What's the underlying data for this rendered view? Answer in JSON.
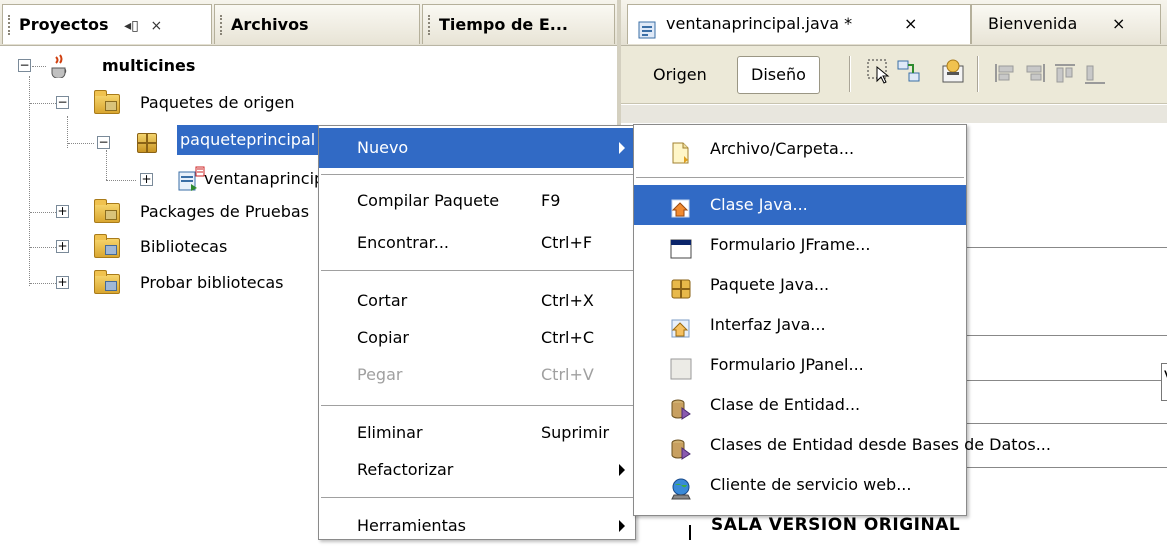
{
  "projects_panel": {
    "tabs": [
      {
        "label": "Proyectos",
        "active": true
      },
      {
        "label": "Archivos",
        "active": false
      },
      {
        "label": "Tiempo de E...",
        "active": false
      }
    ],
    "tab_buttons": {
      "restore": "◂▯",
      "close": "×"
    },
    "tree": {
      "root": "multicines",
      "source_packages": "Paquetes de origen",
      "selected_package": "paqueteprincipal",
      "java_file": "ventanaprincipal.java",
      "test_packages": "Packages de Pruebas",
      "libraries": "Bibliotecas",
      "test_libraries": "Probar bibliotecas"
    }
  },
  "editor": {
    "tabs": [
      {
        "label": "ventanaprincipal.java *",
        "close": "×",
        "active": true
      },
      {
        "label": "Bienvenida",
        "close": "×",
        "active": false
      }
    ],
    "toolbar": {
      "source_label": "Origen",
      "design_label": "Diseño",
      "design_pressed": true
    },
    "canvas_text": "SALA VERSION ORIGINAL",
    "canvas_partial_text": "Va"
  },
  "context_menu": {
    "items": [
      {
        "label": "Nuevo",
        "accelerator": "",
        "submenu": true,
        "selected": true,
        "disabled": false
      },
      {
        "label": "Compilar Paquete",
        "accelerator": "F9",
        "submenu": false,
        "selected": false,
        "disabled": false
      },
      {
        "label": "Encontrar...",
        "accelerator": "Ctrl+F",
        "submenu": false,
        "selected": false,
        "disabled": false
      },
      {
        "label": "Cortar",
        "accelerator": "Ctrl+X",
        "submenu": false,
        "selected": false,
        "disabled": false
      },
      {
        "label": "Copiar",
        "accelerator": "Ctrl+C",
        "submenu": false,
        "selected": false,
        "disabled": false
      },
      {
        "label": "Pegar",
        "accelerator": "Ctrl+V",
        "submenu": false,
        "selected": false,
        "disabled": true
      },
      {
        "label": "Eliminar",
        "accelerator": "Suprimir",
        "submenu": false,
        "selected": false,
        "disabled": false
      },
      {
        "label": "Refactorizar",
        "accelerator": "",
        "submenu": true,
        "selected": false,
        "disabled": false
      },
      {
        "label": "Herramientas",
        "accelerator": "",
        "submenu": true,
        "selected": false,
        "disabled": false
      }
    ]
  },
  "submenu": {
    "items": [
      {
        "label": "Archivo/Carpeta...",
        "icon": "new-file-icon",
        "selected": false
      },
      {
        "label": "Clase Java...",
        "icon": "java-class-icon",
        "selected": true
      },
      {
        "label": "Formulario JFrame...",
        "icon": "jframe-form-icon",
        "selected": false
      },
      {
        "label": "Paquete Java...",
        "icon": "java-package-icon",
        "selected": false
      },
      {
        "label": "Interfaz Java...",
        "icon": "java-interface-icon",
        "selected": false
      },
      {
        "label": "Formulario JPanel...",
        "icon": "jpanel-form-icon",
        "selected": false
      },
      {
        "label": "Clase de Entidad...",
        "icon": "entity-class-icon",
        "selected": false
      },
      {
        "label": "Clases de Entidad desde Bases de Datos...",
        "icon": "entity-db-icon",
        "selected": false
      },
      {
        "label": "Cliente de servicio web...",
        "icon": "web-service-client-icon",
        "selected": false
      }
    ]
  },
  "colors": {
    "selection": "#316ac5",
    "toolbar_bg": "#ece9d8",
    "folder": "#e8b94a"
  }
}
